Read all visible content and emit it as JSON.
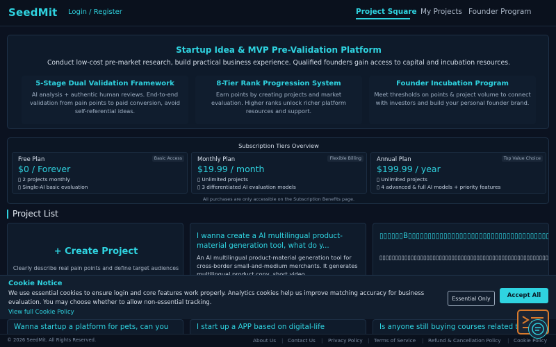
{
  "header": {
    "logo": "SeedMit",
    "login": "Login / Register",
    "nav": [
      "Project Square",
      "My Projects",
      "Founder Program"
    ]
  },
  "hero": {
    "title": "Startup Idea & MVP Pre-Validation Platform",
    "subtitle": "Conduct low-cost pre-market research, build practical business experience. Qualified founders gain access to capital and incubation resources.",
    "features": [
      {
        "title": "5-Stage Dual Validation Framework",
        "desc": "AI analysis + authentic human reviews. End-to-end validation from pain points to paid conversion, avoid self-referential ideas."
      },
      {
        "title": "8-Tier Rank Progression System",
        "desc": "Earn points by creating projects and market evaluation. Higher ranks unlock richer platform resources and support."
      },
      {
        "title": "Founder Incubation Program",
        "desc": "Meet thresholds on points & project volume to connect with investors and build your personal founder brand."
      }
    ]
  },
  "subscriptions": {
    "title": "Subscription Tiers Overview",
    "note": "All purchases are only accessible on the Subscription Benefits page.",
    "tiers": [
      {
        "name": "Free Plan",
        "badge": "Basic Access",
        "price": "$0 / Forever",
        "f1": "▯ 2 projects monthly",
        "f2": "▯ Single-AI basic evaluation"
      },
      {
        "name": "Monthly Plan",
        "badge": "Flexible Billing",
        "price": "$19.99 / month",
        "f1": "▯ Unlimited projects",
        "f2": "▯ 3 differentiated AI evaluation models"
      },
      {
        "name": "Annual Plan",
        "badge": "Top Value Choice",
        "price": "$199.99 / year",
        "f1": "▯ Unlimited projects",
        "f2": "▯ 4 advanced & full AI models + priority features"
      }
    ]
  },
  "projects": {
    "title": "Project List",
    "create": {
      "title": "+ Create Project",
      "subtitle": "Clearly describe real pain points and define target audiences"
    },
    "cards": [
      {
        "title": "I wanna create a AI multilingual product-material generation tool, what do y...",
        "desc": "An AI multilingual product-material generation tool for cross-border small-and-medium merchants. It generates multilingual product copy, short video..."
      },
      {
        "title": "▯▯▯▯▯▯B▯▯▯▯▯▯▯▯▯▯▯▯▯▯▯▯▯▯▯▯▯▯▯▯▯▯▯▯▯▯▯▯▯▯▯▯▯▯▯▯▯▯▯▯▯▯▯▯▯▯▯▯",
        "desc": "▯▯▯▯▯▯▯▯▯▯▯▯▯▯▯▯▯▯▯▯▯▯▯▯▯▯▯▯▯▯▯▯▯▯▯▯▯▯▯▯▯▯▯▯▯▯▯▯▯▯▯▯▯▯▯▯▯▯▯▯▯▯▯▯▯▯AI▯▯▯▯▯▯▯▯▯▯B▯▯▯▯▯▯▯▯▯▯▯▯▯▯▯▯▯▯▯▯▯▯▯YouTube▯TikTok▯▯▯▯▯▯"
      }
    ],
    "row2": [
      "Wanna startup a platform for pets, can you",
      "I start up a APP based on digital-life",
      "Is anyone still buying courses related to"
    ]
  },
  "cookie": {
    "title": "Cookie Notice",
    "text": "We use essential cookies to ensure login and core features work properly. Analytics cookies help us improve matching accuracy for business evaluation. You may choose whether to allow non-essential tracking.",
    "link": "View full Cookie Policy",
    "essential_btn": "Essential Only",
    "accept_btn": "Accept All"
  },
  "footer": {
    "copyright": "© 2026 SeedMit. All Rights Reserved.",
    "links": [
      "About Us",
      "Contact Us",
      "Privacy Policy",
      "Terms of Service",
      "Refund & Cancellation Policy",
      "Cookie Policy"
    ]
  },
  "colors": {
    "accent": "#2fd3e0",
    "background": "#0b1220",
    "float_border": "#d87a2c"
  }
}
